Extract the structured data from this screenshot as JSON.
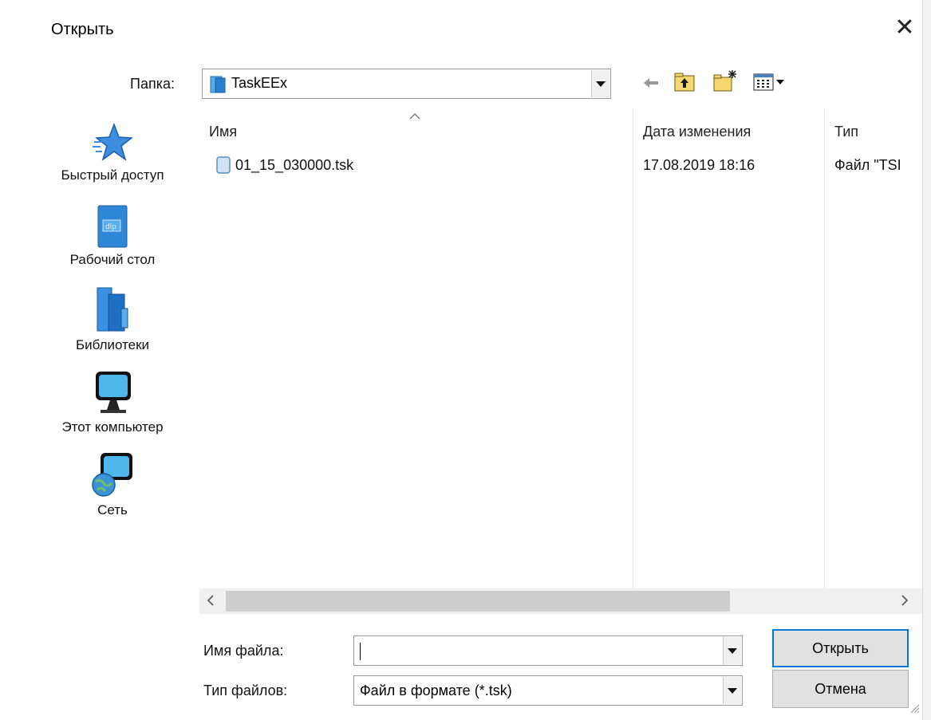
{
  "dialog": {
    "title": "Открыть",
    "close_glyph": "✕"
  },
  "toolbar": {
    "folder_label": "Папка:",
    "folder_value": "TaskEEx",
    "icons": [
      "back-arrow-icon",
      "up-folder-icon",
      "new-folder-icon",
      "view-menu-icon"
    ]
  },
  "sidebar": {
    "items": [
      {
        "label": "Быстрый доступ",
        "icon": "quick-access-star-icon"
      },
      {
        "label": "Рабочий стол",
        "icon": "desktop-icon"
      },
      {
        "label": "Библиотеки",
        "icon": "libraries-icon"
      },
      {
        "label": "Этот компьютер",
        "icon": "computer-icon"
      },
      {
        "label": "Сеть",
        "icon": "network-icon"
      }
    ]
  },
  "list": {
    "columns": [
      "Имя",
      "Дата изменения",
      "Тип"
    ],
    "rows": [
      {
        "name": "01_15_030000.tsk",
        "date": "17.08.2019 18:16",
        "type": "Файл \"TSI"
      }
    ]
  },
  "footer": {
    "filename_label": "Имя файла:",
    "filename_value": "",
    "filetype_label": "Тип файлов:",
    "filetype_value": "Файл в формате (*.tsk)",
    "open_button": "Открыть",
    "cancel_button": "Отмена"
  },
  "colors": {
    "accent": "#0078d7",
    "button_bg": "#e1e1e1",
    "folder_blue": "#2b7fd0"
  }
}
